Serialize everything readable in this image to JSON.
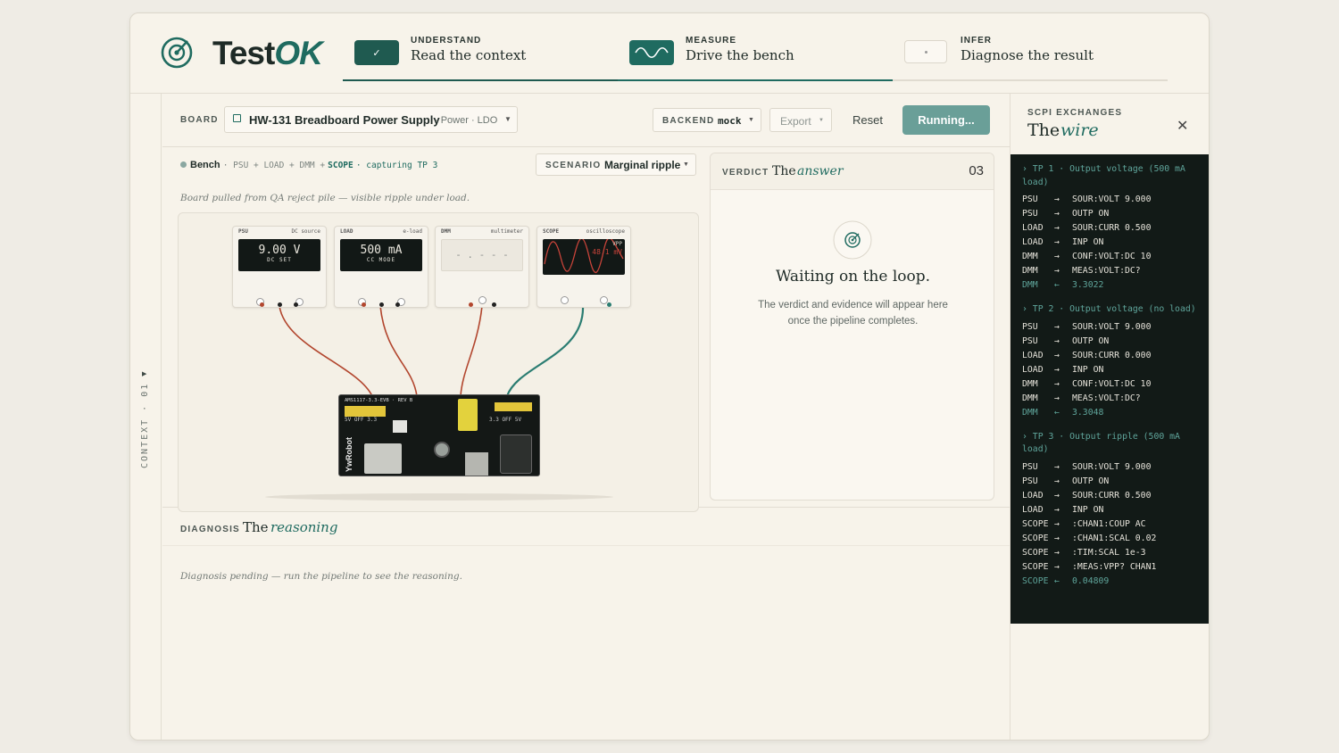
{
  "brand": {
    "name_a": "Test",
    "name_b": "OK"
  },
  "steps": [
    {
      "kicker": "UNDERSTAND",
      "title": "Read the context",
      "icon": "check-icon",
      "state": "done"
    },
    {
      "kicker": "MEASURE",
      "title": "Drive the bench",
      "icon": "wave-icon",
      "state": "active"
    },
    {
      "kicker": "INFER",
      "title": "Diagnose the result",
      "icon": "dot-icon",
      "state": "pending"
    }
  ],
  "sidebar": {
    "label": "CONTEXT · 01"
  },
  "toolbar": {
    "board_label": "BOARD",
    "board_name": "HW-131 Breadboard Power Supply",
    "board_tags": "· Power · LDO",
    "backend_label": "BACKEND",
    "backend_value": "mock",
    "export_label": "Export",
    "reset_label": "Reset",
    "run_label": "Running..."
  },
  "bench": {
    "title": "Bench",
    "chain_a": "· PSU + LOAD + DMM +",
    "chain_scope": "SCOPE",
    "capturing": "· capturing TP 3",
    "scenario_label": "SCENARIO",
    "scenario_value": "Marginal ripple",
    "note": "Board pulled from QA reject pile — visible ripple under load.",
    "instruments": [
      {
        "name": "PSU",
        "kind": "DC source",
        "reading": "9.00 V",
        "mode": "DC SET"
      },
      {
        "name": "LOAD",
        "kind": "e-load",
        "reading": "500 mA",
        "mode": "CC MODE"
      },
      {
        "name": "DMM",
        "kind": "multimeter",
        "reading": "- . - - -",
        "mode": ""
      },
      {
        "name": "SCOPE",
        "kind": "oscilloscope",
        "vpp_label": "VPP",
        "reading": "48.1 mV"
      }
    ],
    "board_silk": "AMS1117-3.3-EVB · REV B",
    "board_silk_2": "YwRobot",
    "board_pin_a": "5V OFF 3.3",
    "board_pin_b": "3.3 OFF 5V"
  },
  "verdict": {
    "label": "VERDICT",
    "title_a": "The",
    "title_b": "answer",
    "number": "03",
    "heading": "Waiting on the loop.",
    "body": "The verdict and evidence will appear here once the pipeline completes."
  },
  "diagnosis": {
    "label": "DIAGNOSIS",
    "title_a": "The",
    "title_b": "reasoning",
    "body": "Diagnosis pending — run the pipeline to see the reasoning."
  },
  "scpi": {
    "kicker": "SCPI EXCHANGES",
    "title_a": "The",
    "title_b": "wire",
    "blocks": [
      {
        "title": "›  TP 1 · Output voltage (500 mA load)",
        "rows": [
          {
            "dev": "PSU",
            "dir": "→",
            "cmd": "SOUR:VOLT 9.000"
          },
          {
            "dev": "PSU",
            "dir": "→",
            "cmd": "OUTP ON"
          },
          {
            "dev": "LOAD",
            "dir": "→",
            "cmd": "SOUR:CURR 0.500"
          },
          {
            "dev": "LOAD",
            "dir": "→",
            "cmd": "INP ON"
          },
          {
            "dev": "DMM",
            "dir": "→",
            "cmd": "CONF:VOLT:DC 10"
          },
          {
            "dev": "DMM",
            "dir": "→",
            "cmd": "MEAS:VOLT:DC?"
          },
          {
            "dev": "DMM",
            "dir": "←",
            "cmd": "3.3022",
            "resp": true
          }
        ]
      },
      {
        "title": "›  TP 2 · Output voltage (no load)",
        "rows": [
          {
            "dev": "PSU",
            "dir": "→",
            "cmd": "SOUR:VOLT 9.000"
          },
          {
            "dev": "PSU",
            "dir": "→",
            "cmd": "OUTP ON"
          },
          {
            "dev": "LOAD",
            "dir": "→",
            "cmd": "SOUR:CURR 0.000"
          },
          {
            "dev": "LOAD",
            "dir": "→",
            "cmd": "INP ON"
          },
          {
            "dev": "DMM",
            "dir": "→",
            "cmd": "CONF:VOLT:DC 10"
          },
          {
            "dev": "DMM",
            "dir": "→",
            "cmd": "MEAS:VOLT:DC?"
          },
          {
            "dev": "DMM",
            "dir": "←",
            "cmd": "3.3048",
            "resp": true
          }
        ]
      },
      {
        "title": "›  TP 3 · Output ripple (500 mA load)",
        "rows": [
          {
            "dev": "PSU",
            "dir": "→",
            "cmd": "SOUR:VOLT 9.000"
          },
          {
            "dev": "PSU",
            "dir": "→",
            "cmd": "OUTP ON"
          },
          {
            "dev": "LOAD",
            "dir": "→",
            "cmd": "SOUR:CURR 0.500"
          },
          {
            "dev": "LOAD",
            "dir": "→",
            "cmd": "INP ON"
          },
          {
            "dev": "SCOPE",
            "dir": "→",
            "cmd": ":CHAN1:COUP AC"
          },
          {
            "dev": "SCOPE",
            "dir": "→",
            "cmd": ":CHAN1:SCAL 0.02"
          },
          {
            "dev": "SCOPE",
            "dir": "→",
            "cmd": ":TIM:SCAL 1e-3"
          },
          {
            "dev": "SCOPE",
            "dir": "→",
            "cmd": ":MEAS:VPP? CHAN1"
          },
          {
            "dev": "SCOPE",
            "dir": "←",
            "cmd": "0.04809",
            "resp": true
          }
        ]
      }
    ]
  },
  "colors": {
    "accent": "#1f6b60",
    "run_button": "#6a9f98",
    "terminal_bg": "#121a17",
    "wire_red": "#b2462e",
    "wire_teal": "#2b7d72"
  }
}
